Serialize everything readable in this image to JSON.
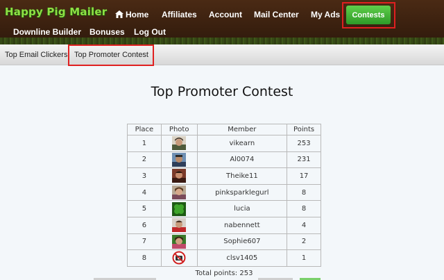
{
  "header": {
    "logo": "Happy Pig Mailer",
    "nav": {
      "home": "Home",
      "affiliates": "Affiliates",
      "account": "Account",
      "mail_center": "Mail Center",
      "my_ads": "My Ads",
      "contests": "Contests",
      "downline_builder": "Downline Builder",
      "bonuses": "Bonuses",
      "log_out": "Log Out"
    },
    "accent_color": "#3cb534",
    "highlight_color": "#e02020"
  },
  "subnav": {
    "items": [
      "Top Email Clickers",
      "Top Promoter Contest"
    ],
    "active": "Top Promoter Contest"
  },
  "main": {
    "title": "Top Promoter Contest",
    "table": {
      "headers": [
        "Place",
        "Photo",
        "Member",
        "Points"
      ],
      "rows": [
        {
          "place": "1",
          "photo": "avatar-photo",
          "member": "vikearn",
          "points": "253"
        },
        {
          "place": "2",
          "photo": "avatar-photo",
          "member": "Al0074",
          "points": "231"
        },
        {
          "place": "3",
          "photo": "avatar-photo",
          "member": "Theike11",
          "points": "17"
        },
        {
          "place": "4",
          "photo": "avatar-photo",
          "member": "pinksparklegurl",
          "points": "8"
        },
        {
          "place": "5",
          "photo": "clover-avatar",
          "member": "lucia",
          "points": "8"
        },
        {
          "place": "6",
          "photo": "avatar-photo",
          "member": "nabennett",
          "points": "4"
        },
        {
          "place": "7",
          "photo": "avatar-photo",
          "member": "Sophie607",
          "points": "2"
        },
        {
          "place": "8",
          "photo": "no-photo-icon",
          "member": "clsv1405",
          "points": "1"
        }
      ]
    },
    "total": "Total points: 253"
  }
}
